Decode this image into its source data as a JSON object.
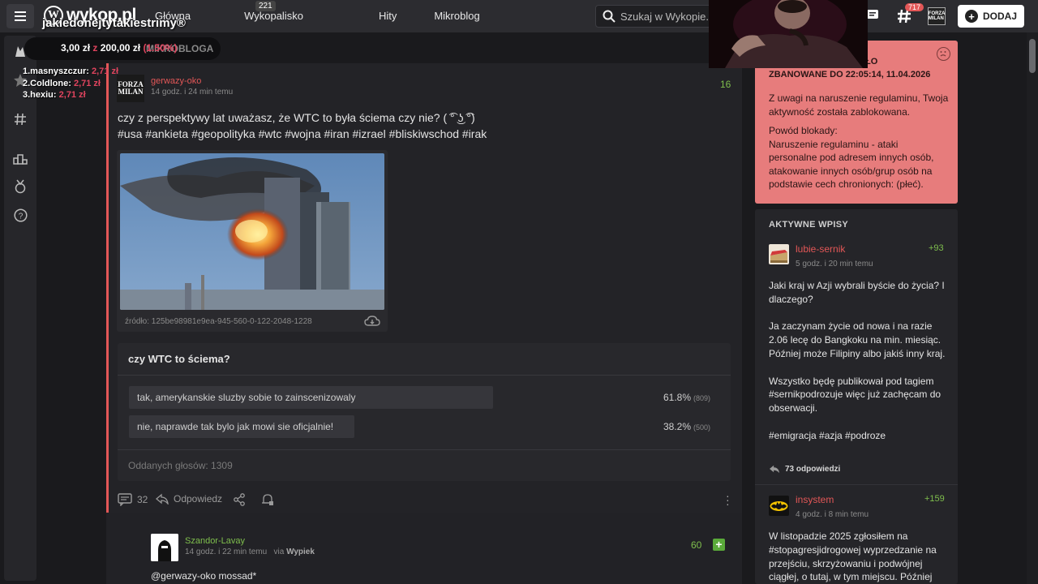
{
  "header": {
    "logo_text": "wykop.pl",
    "nav": [
      {
        "label": "Główna"
      },
      {
        "label": "Wykopalisko",
        "badge": "221"
      },
      {
        "label": "Hity"
      },
      {
        "label": "Mikroblog"
      }
    ],
    "search_placeholder": "Szukaj w Wykopie...",
    "notifications_badge": "717",
    "avatar_label": "FORZA MILAN",
    "add_button": "DODAJ"
  },
  "stream_overlay": {
    "title": "jakiedonejtytakiestrimy®",
    "money_current": "3,00 zł",
    "money_z": "z",
    "money_goal": "200,00 zł",
    "money_pct": "(1.50%)",
    "bloga": "MIKROBLOGA",
    "leaderboard": [
      {
        "name": "1.masnyszczur:",
        "value": "2,71 zł"
      },
      {
        "name": "2.Coldlone:",
        "value": "2,71 zł"
      },
      {
        "name": "3.hexiu:",
        "value": "2,71 zł"
      }
    ]
  },
  "post": {
    "author": "gerwazy-oko",
    "avatar_text": "FORZA MILAN",
    "time": "14 godz. i 24 min temu",
    "votes": "16",
    "text": "czy z perspektywy lat uważasz, że WTC to była ściema czy nie? ( ͡° ͜ʖ ͡°)",
    "tags": "#usa #ankieta #geopolityka #wtc #wojna #iran #izrael #bliskiwschod #irak",
    "image_source": "źródło: 125be98981e9ea-945-560-0-122-2048-1228",
    "poll": {
      "question": "czy WTC to ściema?",
      "options": [
        {
          "label": "tak, amerykanskie sluzby sobie to zainscenizowaly",
          "percent": "61.8%",
          "count": "(809)",
          "share": 0.618
        },
        {
          "label": "nie, naprawde tak bylo jak mowi sie oficjalnie!",
          "percent": "38.2%",
          "count": "(500)",
          "share": 0.382
        }
      ],
      "total": "Oddanych głosów: 1309"
    },
    "actions": {
      "comments": "32",
      "reply": "Odpowiedz"
    }
  },
  "comment": {
    "author": "Szandor-Lavay",
    "time": "14 godz. i 22 min temu",
    "via_label": "via",
    "via_app": "Wypiek",
    "votes": "60",
    "plus": "+",
    "text": "@gerwazy-oko mossad*"
  },
  "ban_box": {
    "title_line1": "ŁO",
    "title_line2": "ZBANOWANE DO 22:05:14, 11.04.2026",
    "text1": "Z uwagi na naruszenie regulaminu, Twoja aktywność została zablokowana.",
    "text2": "Powód blokady:",
    "text3": "Naruszenie regulaminu - ataki personalne pod adresem innych osób, atakowanie innych osób/grup osób na podstawie cech chronionych: (płeć)."
  },
  "active_entries": {
    "title": "AKTYWNE WPISY",
    "entries": [
      {
        "author": "lubie-sernik",
        "time": "5 godz. i 20 min temu",
        "votes": "+93",
        "text": "Jaki kraj w Azji wybrali byście do życia? I dlaczego?\n\nJa zaczynam życie od nowa i na razie 2.06 lecę do Bangkoku na min. miesiąc. Później może Filipiny albo jakiś inny kraj.\n\nWszystko będę publikował pod tagiem #sernikpodrozuje więc już zachęcam do obserwacji.\n\n#emigracja #azja #podroze",
        "replies": "73 odpowiedzi"
      },
      {
        "author": "insystem",
        "time": "4 godz. i 8 min temu",
        "votes": "+159",
        "text": "W listopadzie 2025 zgłosiłem na #stopagresjidrogowej wyprzedzanie na przejściu, skrzyżowaniu i podwójnej ciągłej, o tutaj, w tym miejscu. Później"
      }
    ]
  },
  "colors": {
    "accent_red": "#e35757",
    "vote_green": "#7fbf4d",
    "ban_bg": "#e77c7c",
    "background": "#1a1a1d"
  }
}
